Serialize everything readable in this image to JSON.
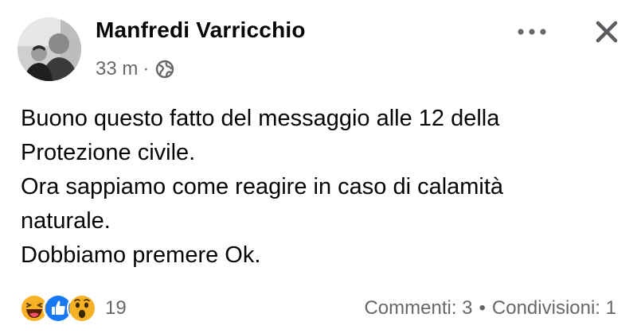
{
  "post": {
    "author": "Manfredi Varricchio",
    "time": "33 m",
    "separator": "·",
    "privacy_icon": "globe-icon",
    "header_actions": {
      "more_icon": "more-horizontal-icon",
      "close_icon": "close-icon"
    },
    "text_lines": [
      "Buono questo fatto del messaggio alle 12 della",
      "Protezione civile.",
      "Ora sappiamo come reagire in caso di calamità",
      "naturale.",
      "Dobbiamo premere Ok."
    ]
  },
  "footer": {
    "reactions": [
      {
        "name": "haha",
        "icon": "haha-reaction-icon"
      },
      {
        "name": "like",
        "icon": "like-reaction-icon"
      },
      {
        "name": "wow",
        "icon": "wow-reaction-icon"
      }
    ],
    "reaction_count": "19",
    "comments": "Commenti: 3",
    "stats_separator": "•",
    "shares": "Condivisioni: 1"
  },
  "colors": {
    "text": "#050505",
    "secondary": "#65676b",
    "like_blue": "#1877f2",
    "reaction_yellow": "#f7b125"
  }
}
